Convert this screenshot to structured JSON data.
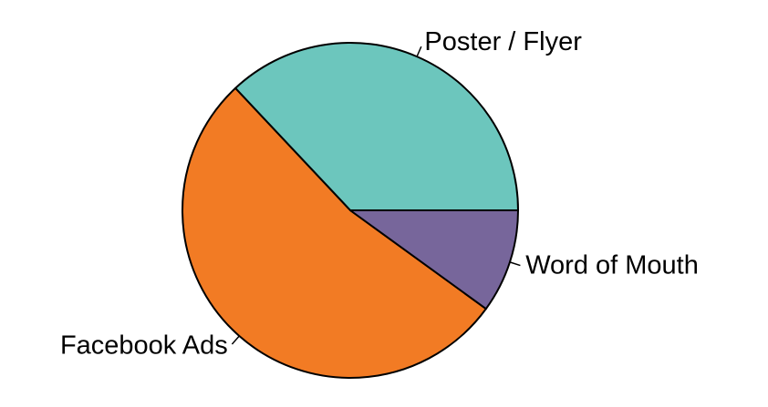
{
  "chart_data": {
    "type": "pie",
    "title": "",
    "start_angle_deg": 0,
    "direction": "counterclockwise",
    "slices": [
      {
        "label": "Poster / Flyer",
        "value": 37,
        "color": "#6cc6bd"
      },
      {
        "label": "Facebook Ads",
        "value": 53,
        "color": "#f27b24"
      },
      {
        "label": "Word of Mouth",
        "value": 10,
        "color": "#77669b"
      }
    ],
    "stroke_color": "#000000",
    "legend": "none"
  }
}
